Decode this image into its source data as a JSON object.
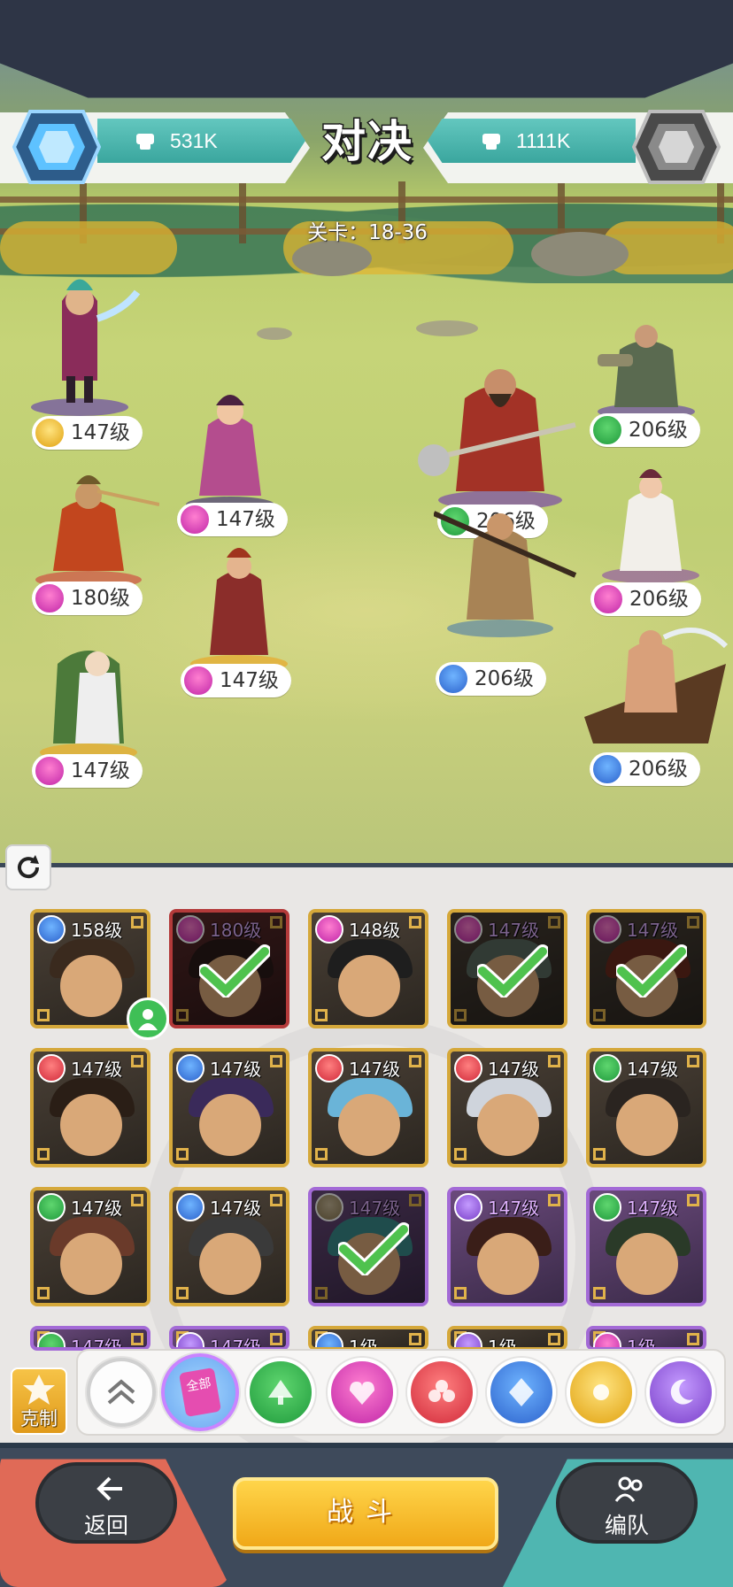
{
  "header": {
    "title": "对决",
    "player_power": "531K",
    "enemy_power": "1111K",
    "stage_label": "关卡：18-36"
  },
  "ally_units": [
    {
      "level": "147级",
      "element": "light"
    },
    {
      "level": "147级",
      "element": "heart"
    },
    {
      "level": "180级",
      "element": "heart"
    },
    {
      "level": "147级",
      "element": "heart"
    },
    {
      "level": "147级",
      "element": "heart"
    }
  ],
  "enemy_units": [
    {
      "level": "206级",
      "element": "wood"
    },
    {
      "level": "206级",
      "element": "wood"
    },
    {
      "level": "206级",
      "element": "heart"
    },
    {
      "level": "206级",
      "element": "water"
    },
    {
      "level": "206级",
      "element": "water"
    }
  ],
  "roster": [
    {
      "level": "158级",
      "element": "water",
      "frame": "gold",
      "selected": false
    },
    {
      "level": "180级",
      "element": "heart",
      "frame": "red",
      "selected": true
    },
    {
      "level": "148级",
      "element": "heart",
      "frame": "gold",
      "selected": false
    },
    {
      "level": "147级",
      "element": "heart",
      "frame": "gold",
      "selected": true
    },
    {
      "level": "147级",
      "element": "heart",
      "frame": "gold",
      "selected": true
    },
    {
      "level": "147级",
      "element": "fire",
      "frame": "gold",
      "selected": false
    },
    {
      "level": "147级",
      "element": "water",
      "frame": "gold",
      "selected": false
    },
    {
      "level": "147级",
      "element": "fire",
      "frame": "gold",
      "selected": false
    },
    {
      "level": "147级",
      "element": "fire",
      "frame": "gold",
      "selected": false
    },
    {
      "level": "147级",
      "element": "wood",
      "frame": "gold",
      "selected": false
    },
    {
      "level": "147级",
      "element": "wood",
      "frame": "gold",
      "selected": false
    },
    {
      "level": "147级",
      "element": "water",
      "frame": "gold",
      "selected": false
    },
    {
      "level": "147级",
      "element": "grey",
      "frame": "purple",
      "selected": true
    },
    {
      "level": "147级",
      "element": "dark",
      "frame": "purple",
      "selected": false
    },
    {
      "level": "147级",
      "element": "wood",
      "frame": "purple",
      "selected": false
    },
    {
      "level": "147级",
      "element": "wood",
      "frame": "purple",
      "selected": false
    },
    {
      "level": "147级",
      "element": "dark",
      "frame": "purple",
      "selected": false
    },
    {
      "level": "1级",
      "element": "water",
      "frame": "gold",
      "selected": false
    },
    {
      "level": "1级",
      "element": "dark",
      "frame": "gold",
      "selected": false
    },
    {
      "level": "1级",
      "element": "heart",
      "frame": "purple",
      "selected": false
    }
  ],
  "filters": {
    "counter_label": "克制",
    "all_label": "全部",
    "items": [
      "collapse",
      "all",
      "wood",
      "heart",
      "fire",
      "water",
      "light",
      "dark"
    ]
  },
  "actions": {
    "back_label": "返回",
    "fight_label": "战斗",
    "team_label": "编队"
  },
  "colors": {
    "accent_teal": "#4fb6b1",
    "back_red": "#e06a57",
    "fight_gold": "#f0a818"
  }
}
